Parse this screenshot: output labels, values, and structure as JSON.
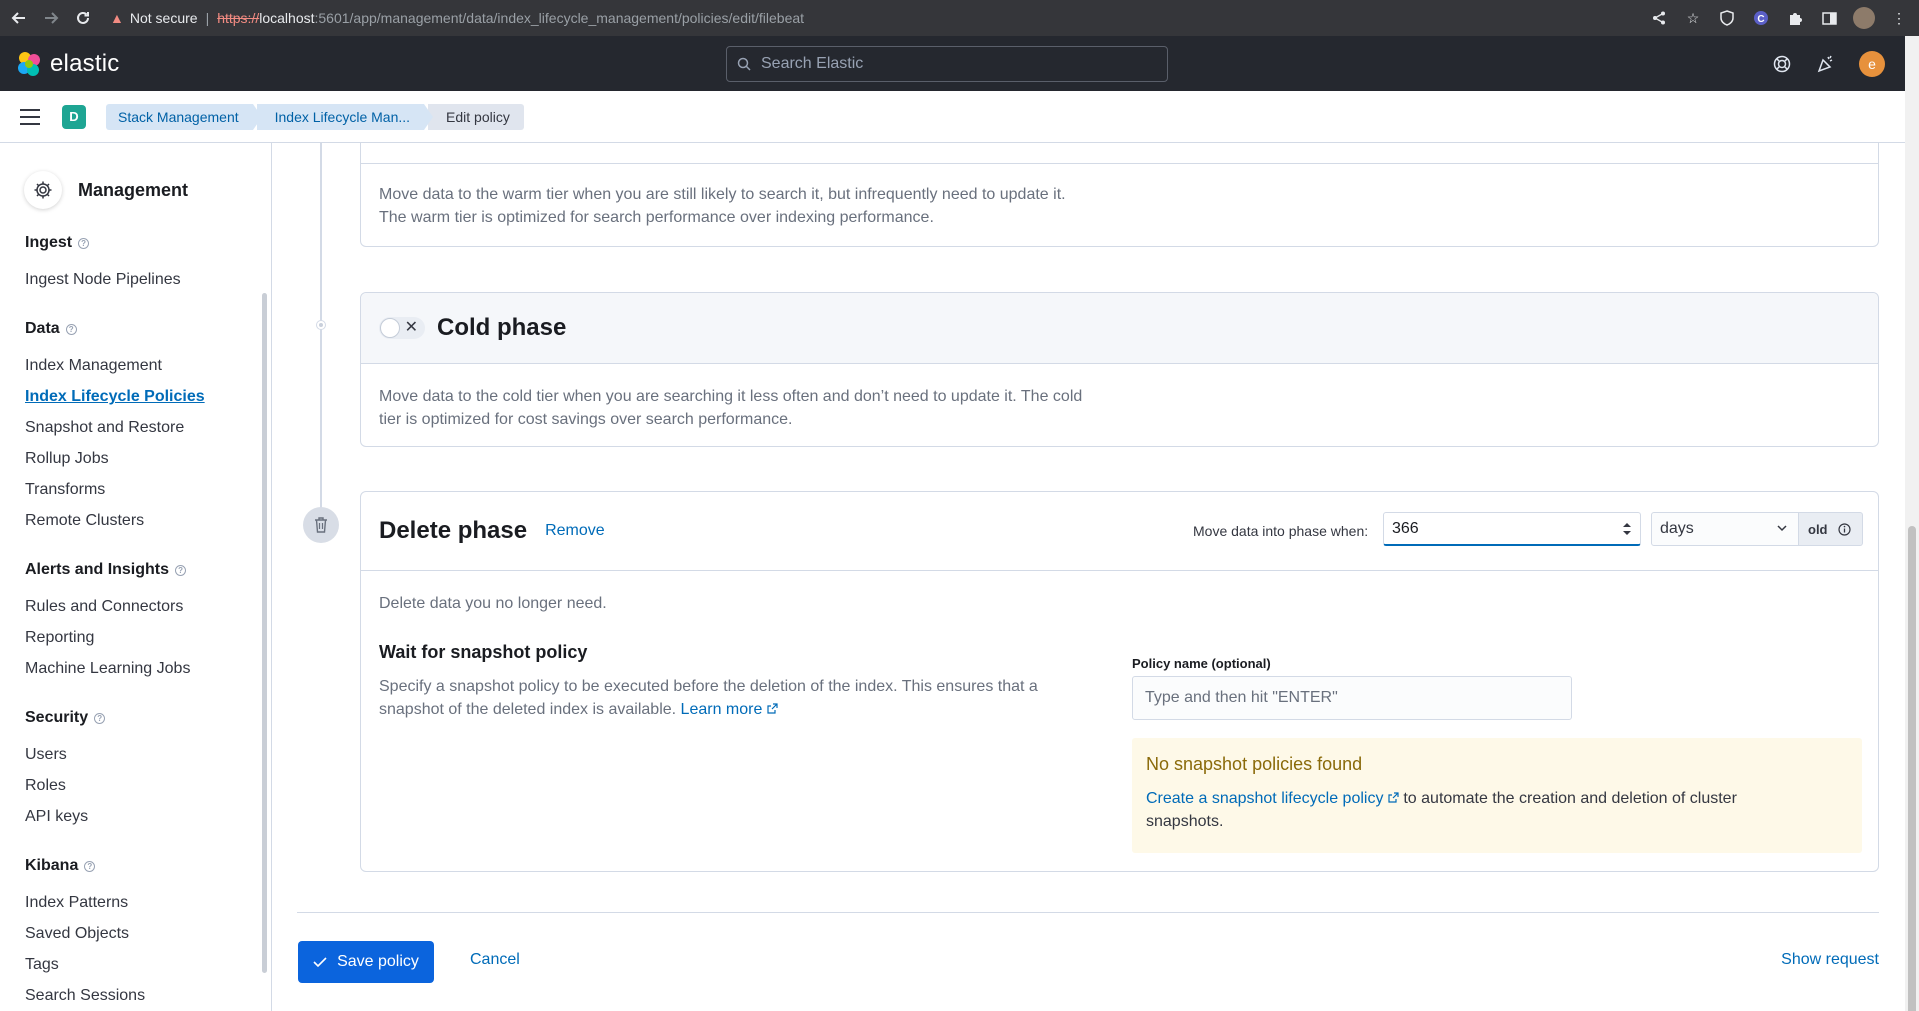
{
  "browser": {
    "not_secure": "Not secure",
    "url_scheme": "https://",
    "url_host": "localhost",
    "url_path": ":5601/app/management/data/index_lifecycle_management/policies/edit/filebeat"
  },
  "header": {
    "logo_text": "elastic",
    "search_placeholder": "Search Elastic",
    "user_initial": "e"
  },
  "breadcrumbs": {
    "space_initial": "D",
    "items": [
      "Stack Management",
      "Index Lifecycle Man...",
      "Edit policy"
    ]
  },
  "sidebar": {
    "title": "Management",
    "sections": [
      {
        "title": "Ingest",
        "items": [
          "Ingest Node Pipelines"
        ]
      },
      {
        "title": "Data",
        "items": [
          "Index Management",
          "Index Lifecycle Policies",
          "Snapshot and Restore",
          "Rollup Jobs",
          "Transforms",
          "Remote Clusters"
        ]
      },
      {
        "title": "Alerts and Insights",
        "items": [
          "Rules and Connectors",
          "Reporting",
          "Machine Learning Jobs"
        ]
      },
      {
        "title": "Security",
        "items": [
          "Users",
          "Roles",
          "API keys"
        ]
      },
      {
        "title": "Kibana",
        "items": [
          "Index Patterns",
          "Saved Objects",
          "Tags",
          "Search Sessions"
        ]
      }
    ],
    "active_item": "Index Lifecycle Policies"
  },
  "warm": {
    "description_1": "Move data to the warm tier when you are still likely to search it, but infrequently need to update it.",
    "description_2": "The warm tier is optimized for search performance over indexing performance."
  },
  "cold": {
    "title": "Cold phase",
    "description_1": "Move data to the cold tier when you are searching it less often and don’t need to update it. The cold",
    "description_2": "tier is optimized for cost savings over search performance."
  },
  "delete": {
    "title": "Delete phase",
    "remove_label": "Remove",
    "move_label": "Move data into phase when:",
    "min_age_value": "366",
    "unit": "days",
    "append": "old",
    "description": "Delete data you no longer need.",
    "wait_title": "Wait for snapshot policy",
    "wait_desc_1": "Specify a snapshot policy to be executed before the deletion of the index. This ensures that a",
    "wait_desc_2": "snapshot of the deleted index is available.",
    "learn_more": "Learn more",
    "policy_label": "Policy name (optional)",
    "policy_placeholder": "Type and then hit \"ENTER\"",
    "callout_title": "No snapshot policies found",
    "callout_link": "Create a snapshot lifecycle policy",
    "callout_text_1": "to automate the creation and deletion of cluster",
    "callout_text_2": "snapshots."
  },
  "footer": {
    "save_label": "Save policy",
    "cancel_label": "Cancel",
    "show_request_label": "Show request"
  },
  "colors": {
    "primary": "#0b64dd",
    "link": "#006bb8",
    "header_bg": "#25282f",
    "callout_bg": "#fef9e8"
  }
}
